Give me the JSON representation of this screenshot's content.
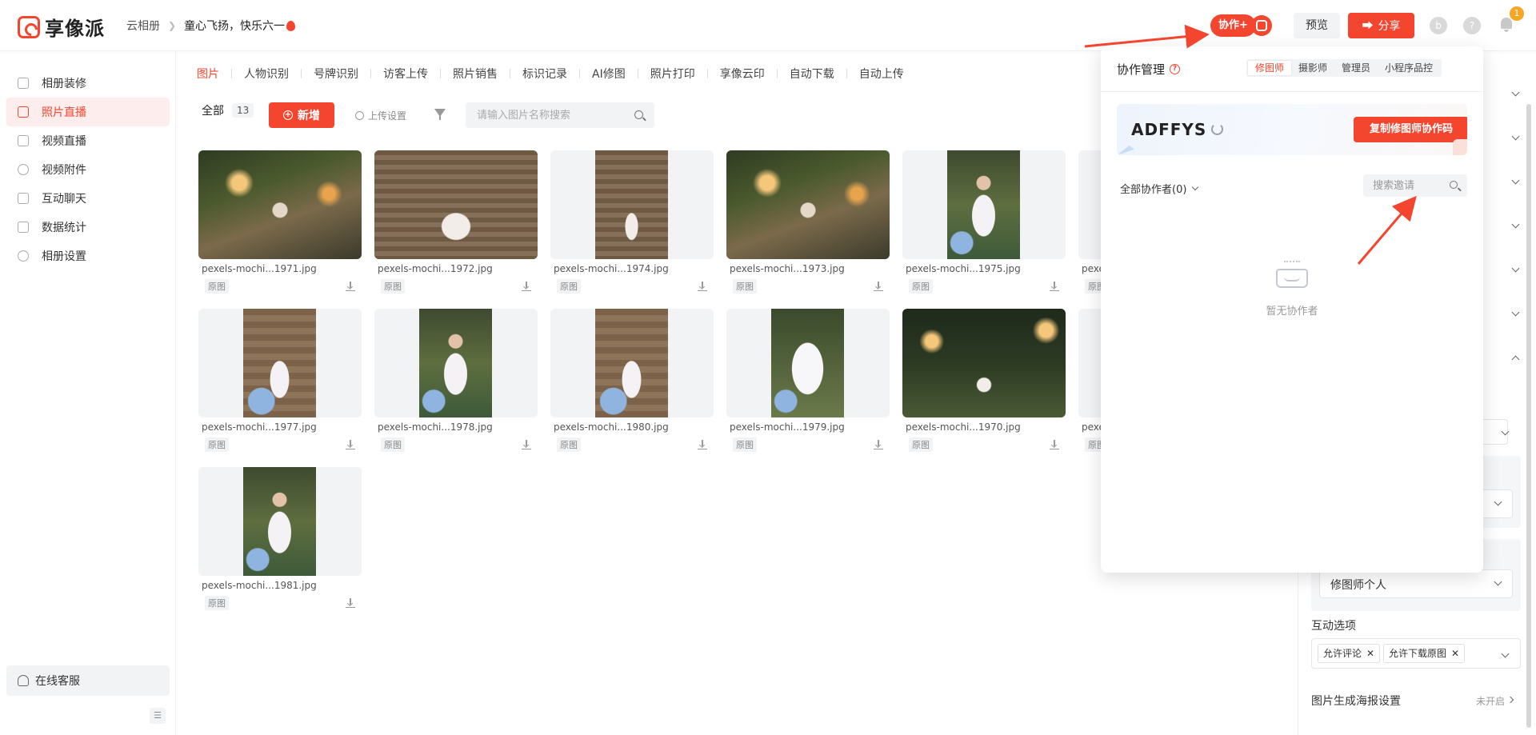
{
  "header": {
    "logo_text": "享像派",
    "breadcrumb": [
      "云相册",
      "童心飞扬，快乐六一"
    ],
    "collab_label": "协作+",
    "preview_label": "预览",
    "share_label": "分享",
    "notification_count": "1",
    "avatar_letter": "b",
    "help_glyph": "?"
  },
  "sidebar": {
    "items": [
      {
        "label": "相册装修",
        "icon": "frame-icon"
      },
      {
        "label": "照片直播",
        "icon": "image-icon"
      },
      {
        "label": "视频直播",
        "icon": "video-icon"
      },
      {
        "label": "视频附件",
        "icon": "paperclip-icon"
      },
      {
        "label": "互动聊天",
        "icon": "chat-icon"
      },
      {
        "label": "数据统计",
        "icon": "chart-icon"
      },
      {
        "label": "相册设置",
        "icon": "gear-icon"
      }
    ],
    "active_index": 1,
    "service_label": "在线客服"
  },
  "main": {
    "tabs": [
      "图片",
      "人物识别",
      "号牌识别",
      "访客上传",
      "照片销售",
      "标识记录",
      "AI修图",
      "照片打印",
      "享像云印",
      "自动下载",
      "自动上传"
    ],
    "active_tab": 0,
    "all_label": "全部",
    "count": "13",
    "add_label": "新增",
    "upload_settings_label": "上传设置",
    "search_placeholder": "请输入图片名称搜索",
    "tag_label": "原图",
    "photos": [
      {
        "name": "pexels-mochi...1971.jpg",
        "theme": "forest",
        "shape": "wide"
      },
      {
        "name": "pexels-mochi...1972.jpg",
        "theme": "path",
        "shape": "wide"
      },
      {
        "name": "pexels-mochi...1974.jpg",
        "theme": "path",
        "shape": "tall"
      },
      {
        "name": "pexels-mochi...1973.jpg",
        "theme": "forest",
        "shape": "wide"
      },
      {
        "name": "pexels-mochi...1975.jpg",
        "theme": "girl",
        "shape": "tall"
      },
      {
        "name": "pexe",
        "theme": "none",
        "shape": "none"
      },
      {
        "name": "pexels-mochi...1977.jpg",
        "theme": "steps",
        "shape": "tall"
      },
      {
        "name": "pexels-mochi...1978.jpg",
        "theme": "girl",
        "shape": "tall"
      },
      {
        "name": "pexels-mochi...1980.jpg",
        "theme": "steps",
        "shape": "tall"
      },
      {
        "name": "pexels-mochi...1979.jpg",
        "theme": "veil",
        "shape": "tall"
      },
      {
        "name": "pexels-mochi...1970.jpg",
        "theme": "lamps",
        "shape": "wide"
      },
      {
        "name": "pexe",
        "theme": "none",
        "shape": "none"
      },
      {
        "name": "pexels-mochi...1981.jpg",
        "theme": "girl",
        "shape": "tall"
      }
    ]
  },
  "right_panel": {
    "retoucher_value": "修图师个人",
    "interaction_label": "互动选项",
    "chips": [
      "允许评论",
      "允许下载原图"
    ],
    "poster_label": "图片生成海报设置",
    "poster_status": "未开启"
  },
  "collab_popover": {
    "title": "协作管理",
    "role_tabs": [
      "修图师",
      "摄影师",
      "管理员",
      "小程序品控"
    ],
    "active_role": 0,
    "code": "ADFFYS",
    "copy_label": "复制修图师协作码",
    "all_collaborators_label": "全部协作者(0)",
    "invite_search_placeholder": "搜索邀请",
    "empty_text": "暂无协作者"
  },
  "annotations": {
    "marker_1": "①",
    "marker_2": "②",
    "color": "#f4452f"
  },
  "colors": {
    "accent": "#f4452f",
    "active_bg": "#fdeeed",
    "badge": "#f5a623"
  }
}
